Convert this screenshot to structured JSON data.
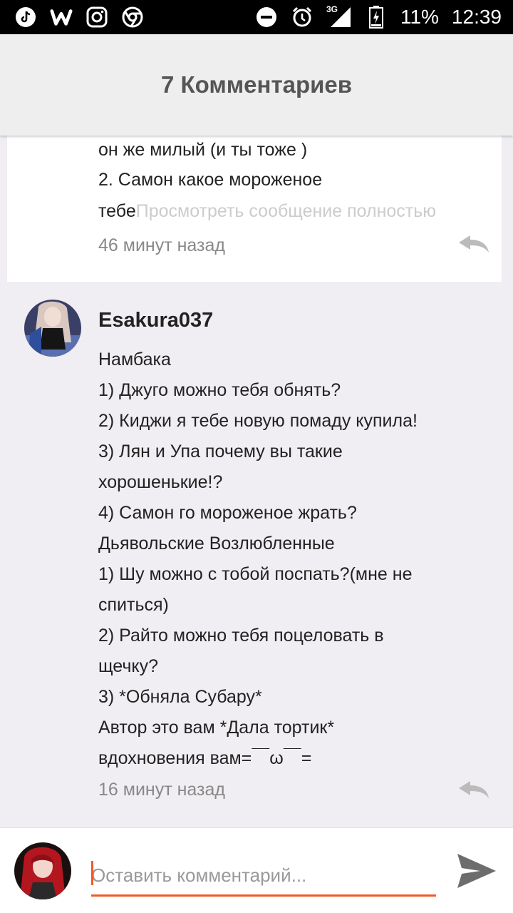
{
  "status_bar": {
    "battery": "11%",
    "time": "12:39",
    "network": "3G",
    "icons": [
      "tiktok-icon",
      "wattpad-icon",
      "instagram-icon",
      "chrome-icon",
      "dnd-icon",
      "alarm-icon",
      "signal-icon",
      "battery-icon"
    ]
  },
  "header": {
    "title": "7 Комментариев"
  },
  "previous_comment": {
    "lines": [
      "он же милый (и ты тоже )",
      "2. Самон какое мороженое"
    ],
    "truncated_text": "тебе",
    "view_full_link": "Просмотреть сообщение полностью",
    "time": "46 минут назад"
  },
  "comment": {
    "username": "Esakura037",
    "lines": [
      "Намбака",
      "1) Джуго можно тебя обнять?",
      "2) Киджи я тебе новую помаду купила!",
      "3) Лян и Упа почему вы такие",
      "хорошенькие!?",
      "4) Самон го мороженое жрать?",
      "Дьявольские Возлюбленные",
      "1) Шу можно с тобой поспать?(мне не",
      "спиться)",
      "2) Райто можно тебя поцеловать в",
      "щечку?",
      "3) *Обняла Субару*",
      "Автор это вам *Дала тортик*",
      "вдохновения вам=￣ω￣="
    ],
    "time": "16 минут назад"
  },
  "composer": {
    "placeholder": "Оставить комментарий...",
    "value": ""
  },
  "colors": {
    "accent": "#f05a28",
    "header_bg": "#eeeeee",
    "list_bg": "#f0eef2"
  }
}
